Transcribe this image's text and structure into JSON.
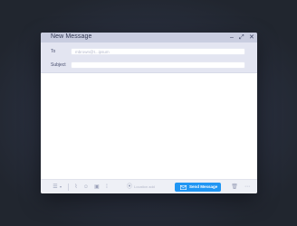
{
  "window": {
    "title": "New Message",
    "controls": {
      "minimize": "–",
      "expand": "⤢",
      "close": "✕"
    }
  },
  "fields": {
    "to_label": "To",
    "to_value": "",
    "to_placeholder": "mbrown@t...ipsum",
    "subject_label": "Subject",
    "subject_value": ""
  },
  "footer": {
    "icons": [
      "list-icon",
      "chevron-down-icon",
      "attachment-icon",
      "emoji-icon",
      "camera-icon",
      "microphone-icon",
      "location-pin-icon"
    ],
    "location_text": "Location add",
    "send_label": "Send Message",
    "trash": "trash-icon",
    "more": "more-icon"
  },
  "colors": {
    "accent": "#2196f3",
    "titlebar": "#c9cde0",
    "background": "#232938"
  }
}
